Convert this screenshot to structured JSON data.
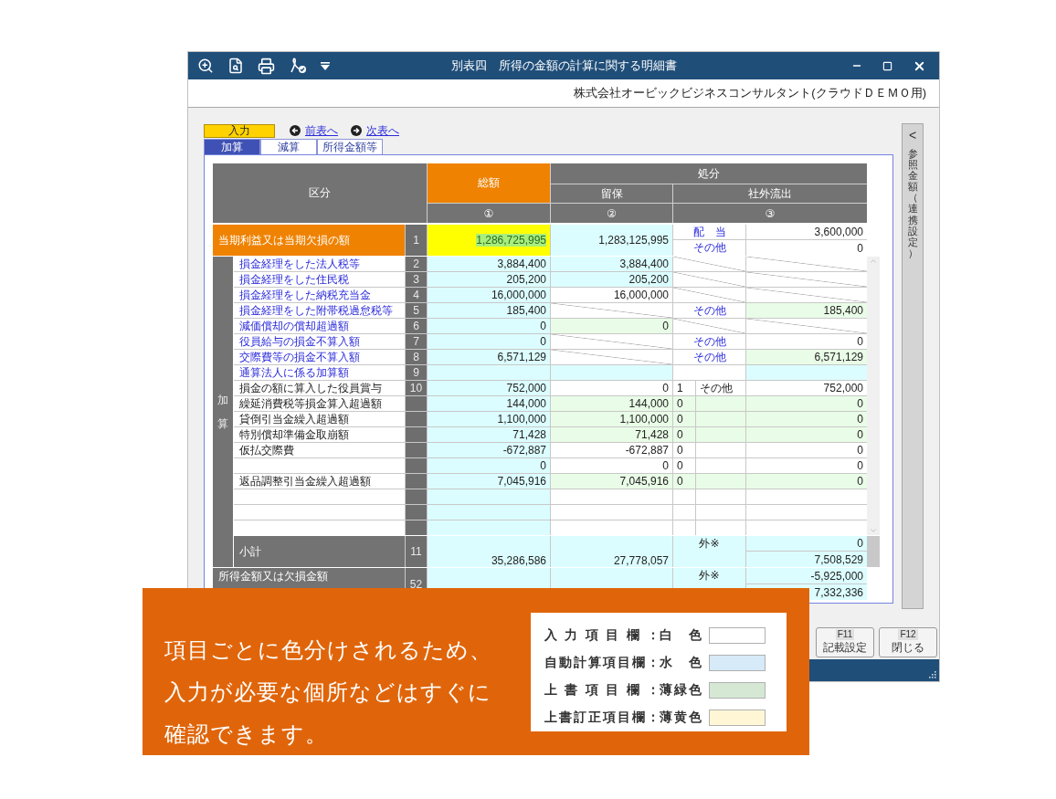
{
  "window": {
    "title": "別表四　所得の金額の計算に関する明細書",
    "company": "株式会社オービックビジネスコンサルタント(クラウドＤＥＭＯ用)"
  },
  "mode_button": {
    "label": "入力"
  },
  "nav_links": [
    {
      "label": "前表へ",
      "kind": "prev"
    },
    {
      "label": "次表へ",
      "kind": "next"
    }
  ],
  "tabs": [
    {
      "label": "加算",
      "selected": true
    },
    {
      "label": "減算",
      "selected": false
    },
    {
      "label": "所得金額等",
      "selected": false
    }
  ],
  "table": {
    "header": {
      "category": "区分",
      "total": "総額",
      "disposition": "処分",
      "retained": "留保",
      "outflow": "社外流出",
      "col_1": "①",
      "col_2": "②",
      "col_3": "③"
    },
    "section_label": "加算",
    "profit_row": {
      "label": "当期利益又は当期欠損の額",
      "no": "1",
      "total": {
        "text": "1,286,725,995",
        "kind": "corrected"
      },
      "retained": {
        "text": "1,283,125,995",
        "kind": "auto"
      },
      "outflow": [
        {
          "label": "配　当",
          "value": "3,600,000",
          "kind": "input"
        },
        {
          "label": "その他",
          "value": "0",
          "kind": "input"
        }
      ]
    },
    "rows": [
      {
        "label": "損金経理をした法人税等",
        "link": true,
        "no": "2",
        "total": {
          "text": "3,884,400",
          "kind": "auto"
        },
        "retained": {
          "text": "3,884,400",
          "kind": "auto"
        },
        "outflow": {
          "label": {
            "kind": "na"
          },
          "value": {
            "kind": "na"
          }
        }
      },
      {
        "label": "損金経理をした住民税",
        "link": true,
        "no": "3",
        "total": {
          "text": "205,200",
          "kind": "auto"
        },
        "retained": {
          "text": "205,200",
          "kind": "auto"
        },
        "outflow": {
          "label": {
            "kind": "na"
          },
          "value": {
            "kind": "na"
          }
        }
      },
      {
        "label": "損金経理をした納税充当金",
        "link": true,
        "no": "4",
        "total": {
          "text": "16,000,000",
          "kind": "auto"
        },
        "retained": {
          "text": "16,000,000",
          "kind": "input"
        },
        "outflow": {
          "label": {
            "kind": "na"
          },
          "value": {
            "kind": "na"
          }
        }
      },
      {
        "label": "損金経理をした附帯税過怠税等",
        "link": true,
        "no": "5",
        "total": {
          "text": "185,400",
          "kind": "auto"
        },
        "retained": {
          "kind": "na"
        },
        "outflow": {
          "label": {
            "text": "その他",
            "kind": "input"
          },
          "value": {
            "text": "185,400",
            "kind": "override"
          }
        }
      },
      {
        "label": "減価償却の償却超過額",
        "link": true,
        "no": "6",
        "total": {
          "text": "0",
          "kind": "auto"
        },
        "retained": {
          "text": "0",
          "kind": "override"
        },
        "outflow": {
          "label": {
            "kind": "na"
          },
          "value": {
            "kind": "na"
          }
        }
      },
      {
        "label": "役員給与の損金不算入額",
        "link": true,
        "no": "7",
        "total": {
          "text": "0",
          "kind": "auto"
        },
        "retained": {
          "kind": "na"
        },
        "outflow": {
          "label": {
            "text": "その他",
            "kind": "input"
          },
          "value": {
            "text": "0",
            "kind": "input"
          }
        }
      },
      {
        "label": "交際費等の損金不算入額",
        "link": true,
        "no": "8",
        "total": {
          "text": "6,571,129",
          "kind": "auto"
        },
        "retained": {
          "kind": "na"
        },
        "outflow": {
          "label": {
            "text": "その他",
            "kind": "input"
          },
          "value": {
            "text": "6,571,129",
            "kind": "override"
          }
        }
      },
      {
        "label": "通算法人に係る加算額",
        "link": true,
        "no": "9",
        "total": {
          "kind": "auto"
        },
        "retained": {
          "kind": "auto"
        },
        "outflow": {
          "label": {
            "kind": "input"
          },
          "value": {
            "kind": "auto"
          }
        }
      },
      {
        "label": "損金の額に算入した役員賞与",
        "link": false,
        "no": "10",
        "total": {
          "text": "752,000",
          "kind": "auto"
        },
        "retained": {
          "text": "0",
          "kind": "input"
        },
        "outflow": {
          "code": {
            "text": "1",
            "kind": "input"
          },
          "label": {
            "text": "その他",
            "kind": "input"
          },
          "value": {
            "text": "752,000",
            "kind": "input"
          }
        }
      },
      {
        "label": "繰延消費税等損金算入超過額",
        "link": false,
        "total": {
          "text": "144,000",
          "kind": "auto"
        },
        "retained": {
          "text": "144,000",
          "kind": "override"
        },
        "outflow": {
          "code": {
            "text": "0",
            "kind": "override"
          },
          "label": {
            "kind": "override"
          },
          "value": {
            "text": "0",
            "kind": "override"
          }
        }
      },
      {
        "label": "貸倒引当金繰入超過額",
        "link": false,
        "total": {
          "text": "1,100,000",
          "kind": "auto"
        },
        "retained": {
          "text": "1,100,000",
          "kind": "override"
        },
        "outflow": {
          "code": {
            "text": "0",
            "kind": "override"
          },
          "label": {
            "kind": "override"
          },
          "value": {
            "text": "0",
            "kind": "override"
          }
        }
      },
      {
        "label": "特別償却準備金取崩額",
        "link": false,
        "total": {
          "text": "71,428",
          "kind": "auto"
        },
        "retained": {
          "text": "71,428",
          "kind": "override"
        },
        "outflow": {
          "code": {
            "text": "0",
            "kind": "override"
          },
          "label": {
            "kind": "override"
          },
          "value": {
            "text": "0",
            "kind": "override"
          }
        }
      },
      {
        "label": "仮払交際費",
        "link": false,
        "total": {
          "text": "-672,887",
          "kind": "auto"
        },
        "retained": {
          "text": "-672,887",
          "kind": "input"
        },
        "outflow": {
          "code": {
            "text": "0",
            "kind": "input"
          },
          "label": {
            "kind": "input"
          },
          "value": {
            "text": "0",
            "kind": "input"
          }
        }
      },
      {
        "total": {
          "text": "0",
          "kind": "auto"
        },
        "retained": {
          "text": "0",
          "kind": "input"
        },
        "outflow": {
          "code": {
            "text": "0",
            "kind": "input"
          },
          "label": {
            "kind": "input"
          },
          "value": {
            "text": "0",
            "kind": "input"
          }
        }
      },
      {
        "label": "返品調整引当金繰入超過額",
        "link": false,
        "total": {
          "text": "7,045,916",
          "kind": "auto"
        },
        "retained": {
          "text": "7,045,916",
          "kind": "override"
        },
        "outflow": {
          "code": {
            "text": "0",
            "kind": "override"
          },
          "label": {
            "kind": "override"
          },
          "value": {
            "text": "0",
            "kind": "override"
          }
        }
      },
      {
        "total": {
          "kind": "auto"
        },
        "retained": {
          "kind": "input"
        },
        "outflow": {
          "code": {
            "kind": "input"
          },
          "label": {
            "kind": "input"
          },
          "value": {
            "kind": "input"
          }
        }
      },
      {
        "total": {
          "kind": "auto"
        },
        "retained": {
          "kind": "input"
        },
        "outflow": {
          "code": {
            "kind": "input"
          },
          "label": {
            "kind": "input"
          },
          "value": {
            "kind": "input"
          }
        }
      },
      {
        "total": {
          "kind": "auto"
        },
        "retained": {
          "kind": "input"
        },
        "outflow": {
          "code": {
            "kind": "input"
          },
          "label": {
            "kind": "input"
          },
          "value": {
            "kind": "input"
          }
        }
      }
    ],
    "subtotal": {
      "label": "小計",
      "no": "11",
      "total": {
        "text": "35,286,586",
        "kind": "auto"
      },
      "retained": {
        "text": "27,778,057",
        "kind": "auto"
      },
      "outflow_label": {
        "text": "外※",
        "kind": "auto"
      },
      "outflow_values": [
        "0",
        "7,508,529"
      ]
    },
    "income_row": {
      "label": "所得金額又は欠損金額",
      "no": "52",
      "total": {
        "kind": "auto"
      },
      "retained": {
        "kind": "auto"
      },
      "outflow_label": {
        "text": "外※",
        "kind": "auto"
      },
      "outflow_values": [
        "-5,925,000",
        "7,332,336"
      ]
    }
  },
  "side_panel": {
    "toggle": "<",
    "label": "参照金額（連携設定）"
  },
  "function_keys": [
    {
      "key": "F11",
      "label": "記載設定"
    },
    {
      "key": "F12",
      "label": "閉じる"
    }
  ],
  "banner": {
    "lines": [
      "項目ごとに色分けされるため、",
      "入力が必要な個所などはすぐに",
      "確認できます。"
    ],
    "legend": [
      {
        "label": "入力項目欄：",
        "color_name": "白色",
        "color": "#ffffff"
      },
      {
        "label": "自動計算項目欄：",
        "color_name": "水色",
        "color": "#d6eaf8"
      },
      {
        "label": "上書項目欄：",
        "color_name": "薄緑色",
        "color": "#d5e8d4"
      },
      {
        "label": "上書訂正項目欄：",
        "color_name": "薄黄色",
        "color": "#fff6d5"
      }
    ]
  }
}
